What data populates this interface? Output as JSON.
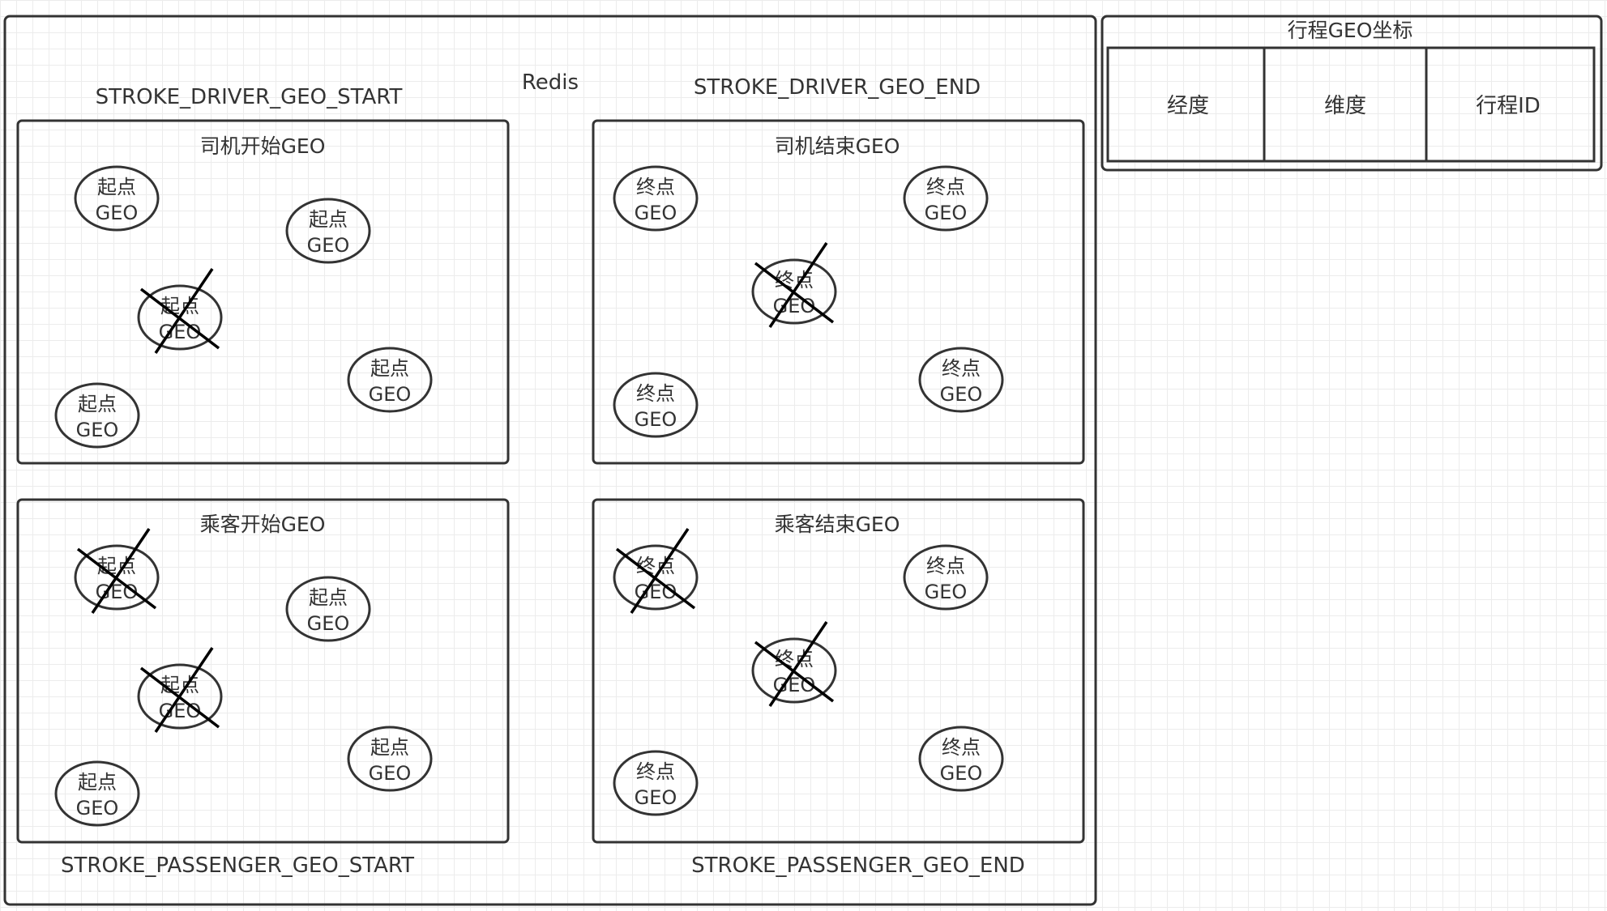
{
  "redis": {
    "label": "Redis",
    "driver_start_key": "STROKE_DRIVER_GEO_START",
    "driver_end_key": "STROKE_DRIVER_GEO_END",
    "passenger_start_key": "STROKE_PASSENGER_GEO_START",
    "passenger_end_key": "STROKE_PASSENGER_GEO_END"
  },
  "groups": {
    "driver_start": {
      "title": "司机开始GEO"
    },
    "driver_end": {
      "title": "司机结束GEO"
    },
    "passenger_start": {
      "title": "乘客开始GEO"
    },
    "passenger_end": {
      "title": "乘客结束GEO"
    }
  },
  "node": {
    "start": "起点",
    "end": "终点",
    "geo": "GEO"
  },
  "table": {
    "title": "行程GEO坐标",
    "columns": [
      "经度",
      "维度",
      "行程ID"
    ]
  }
}
